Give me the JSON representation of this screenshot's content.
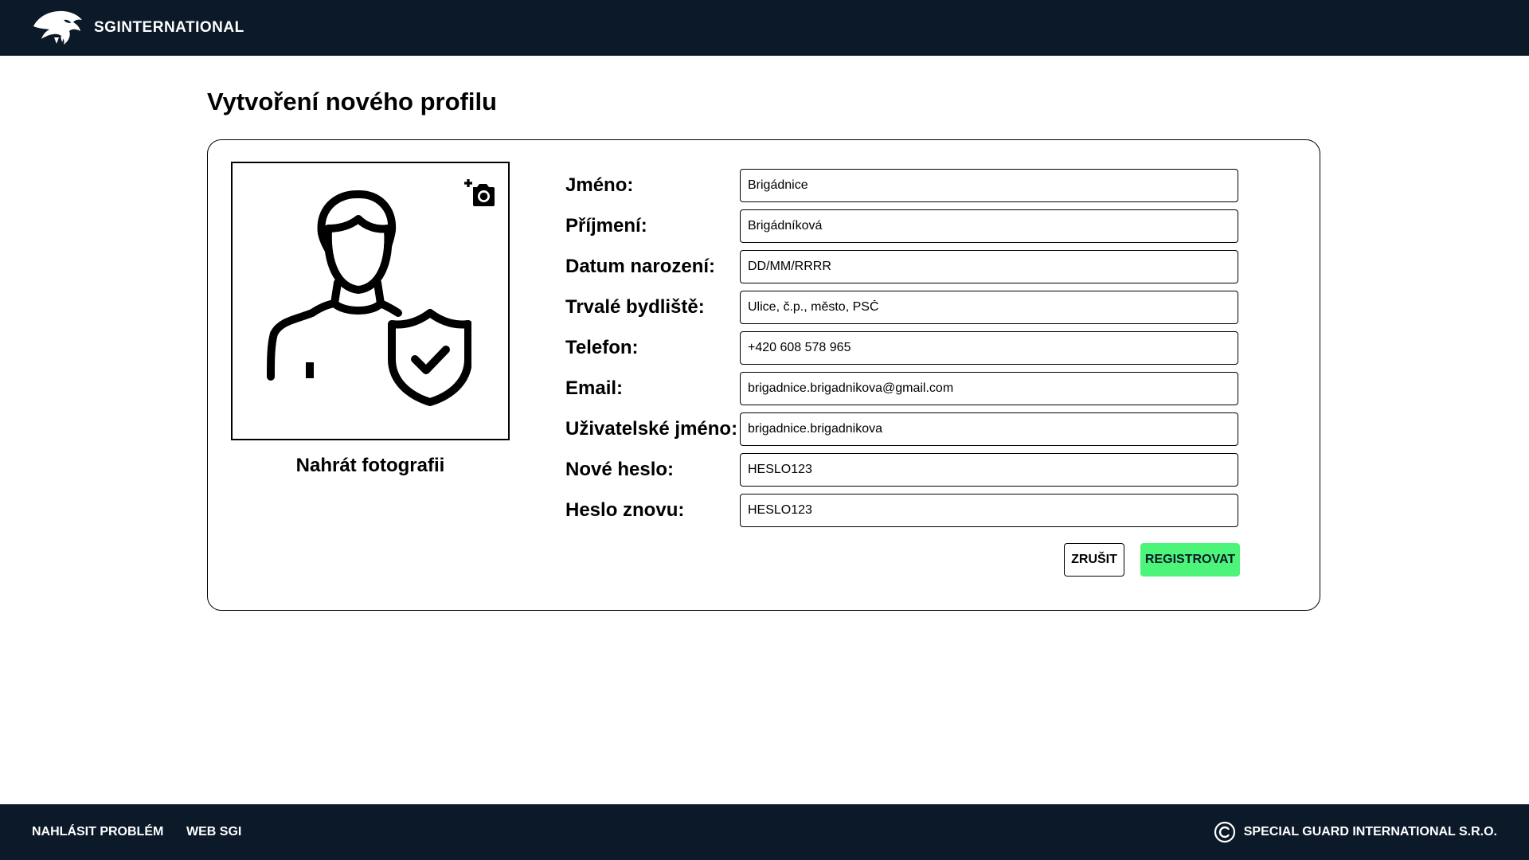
{
  "header": {
    "brand": "SGINTERNATIONAL",
    "background": "#0b1929"
  },
  "page": {
    "title": "Vytvoření nového profilu"
  },
  "photo": {
    "upload_label": "Nahrát fotografii",
    "camera_icon": "add-photo-camera-icon",
    "avatar_icon": "verified-user-icon"
  },
  "form": {
    "fields": [
      {
        "label": "Jméno:",
        "value": "Brigádnice",
        "placeholder": ""
      },
      {
        "label": "Příjmení:",
        "value": "Brigádníková",
        "placeholder": ""
      },
      {
        "label": "Datum narození:",
        "value": "",
        "placeholder": "DD/MM/RRRR"
      },
      {
        "label": "Trvalé bydliště:",
        "value": "",
        "placeholder": "Ulice, č.p., město, PSČ"
      },
      {
        "label": "Telefon:",
        "value": "+420 608 578 965",
        "placeholder": ""
      },
      {
        "label": "Email:",
        "value": "brigadnice.brigadnikova@gmail.com",
        "placeholder": ""
      },
      {
        "label": "Uživatelské jméno:",
        "value": "brigadnice.brigadnikova",
        "placeholder": ""
      },
      {
        "label": "Nové heslo:",
        "value": "HESLO123",
        "placeholder": ""
      },
      {
        "label": "Heslo znovu:",
        "value": "HESLO123",
        "placeholder": ""
      }
    ],
    "cancel_label": "ZRUŠIT",
    "register_label": "REGISTROVAT",
    "register_color": "#4cf57a"
  },
  "footer": {
    "report_label": "NAHLÁSIT PROBLÉM",
    "web_label": "WEB SGI",
    "copyright_label": "SPECIAL GUARD INTERNATIONAL S.R.O.",
    "copyright_icon": "copyright-icon"
  }
}
